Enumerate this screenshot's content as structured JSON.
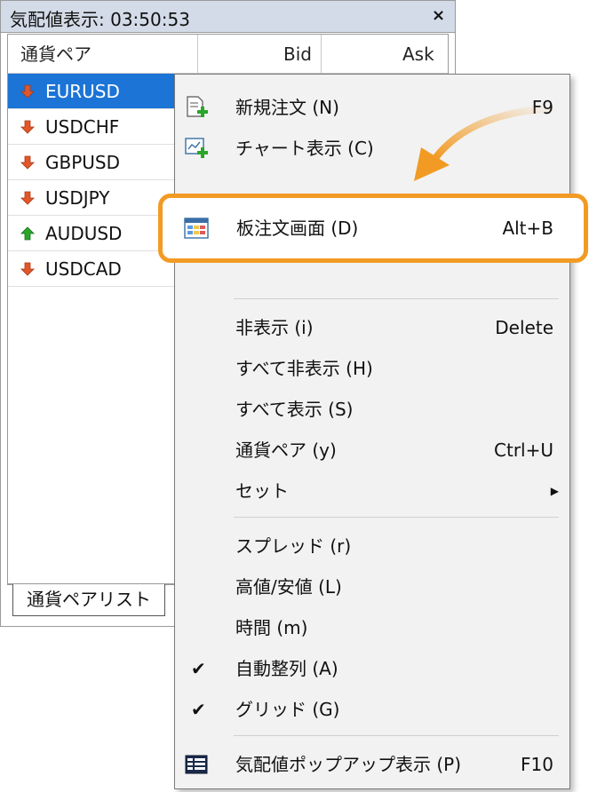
{
  "window": {
    "title": "気配値表示: 03:50:53",
    "close_label": "×"
  },
  "table": {
    "columns": [
      "通貨ペア",
      "Bid",
      "Ask"
    ],
    "rows": [
      {
        "symbol": "EURUSD",
        "direction": "down",
        "selected": true
      },
      {
        "symbol": "USDCHF",
        "direction": "down",
        "selected": false
      },
      {
        "symbol": "GBPUSD",
        "direction": "down",
        "selected": false
      },
      {
        "symbol": "USDJPY",
        "direction": "down",
        "selected": false
      },
      {
        "symbol": "AUDUSD",
        "direction": "up",
        "selected": false
      },
      {
        "symbol": "USDCAD",
        "direction": "down",
        "selected": false
      }
    ]
  },
  "tabs": [
    {
      "label": "通貨ペアリスト",
      "active": true
    }
  ],
  "context_menu": {
    "items": [
      {
        "label": "新規注文 (N)",
        "shortcut": "F9",
        "icon": "new-order-icon"
      },
      {
        "label": "チャート表示 (C)",
        "shortcut": "",
        "icon": "chart-window-icon"
      },
      {
        "label": "板注文画面 (D)",
        "shortcut": "Alt+B",
        "icon": "order-board-icon",
        "highlighted": true
      },
      {
        "label": "非表示 (i)",
        "shortcut": "Delete"
      },
      {
        "label": "すべて非表示 (H)",
        "shortcut": ""
      },
      {
        "label": "すべて表示 (S)",
        "shortcut": ""
      },
      {
        "label": "通貨ペア (y)",
        "shortcut": "Ctrl+U"
      },
      {
        "label": "セット",
        "shortcut": "",
        "submenu": true
      },
      {
        "label": "スプレッド (r)",
        "shortcut": ""
      },
      {
        "label": "高値/安値 (L)",
        "shortcut": ""
      },
      {
        "label": "時間 (m)",
        "shortcut": ""
      },
      {
        "label": "自動整列 (A)",
        "shortcut": "",
        "checked": true
      },
      {
        "label": "グリッド (G)",
        "shortcut": "",
        "checked": true
      },
      {
        "label": "気配値ポップアップ表示 (P)",
        "shortcut": "F10",
        "icon": "popup-prices-icon"
      }
    ]
  },
  "colors": {
    "selection": "#1b74d6",
    "highlight": "#f29b24",
    "down_arrow": "#e2572a",
    "up_arrow": "#2aa52a"
  }
}
